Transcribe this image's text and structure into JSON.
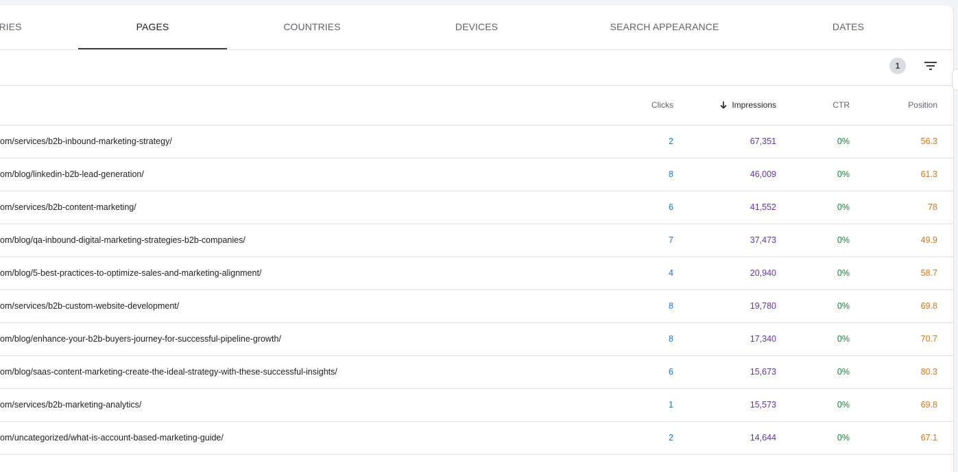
{
  "tabs": [
    {
      "label": "RIES",
      "active": false
    },
    {
      "label": "PAGES",
      "active": true
    },
    {
      "label": "COUNTRIES",
      "active": false
    },
    {
      "label": "DEVICES",
      "active": false
    },
    {
      "label": "SEARCH APPEARANCE",
      "active": false
    },
    {
      "label": "DATES",
      "active": false
    }
  ],
  "toolbar": {
    "filter_count": "1",
    "filter_icon": "filter-list-icon"
  },
  "table": {
    "headers": {
      "clicks": "Clicks",
      "impressions": "Impressions",
      "ctr": "CTR",
      "position": "Position"
    },
    "sort": {
      "column": "impressions",
      "direction": "descending",
      "icon": "arrow-down-icon"
    },
    "rows": [
      {
        "page": "om/services/b2b-inbound-marketing-strategy/",
        "clicks": "2",
        "impressions": "67,351",
        "ctr": "0%",
        "position": "56.3"
      },
      {
        "page": "om/blog/linkedin-b2b-lead-generation/",
        "clicks": "8",
        "impressions": "46,009",
        "ctr": "0%",
        "position": "61.3"
      },
      {
        "page": "om/services/b2b-content-marketing/",
        "clicks": "6",
        "impressions": "41,552",
        "ctr": "0%",
        "position": "78"
      },
      {
        "page": "om/blog/qa-inbound-digital-marketing-strategies-b2b-companies/",
        "clicks": "7",
        "impressions": "37,473",
        "ctr": "0%",
        "position": "49.9"
      },
      {
        "page": "om/blog/5-best-practices-to-optimize-sales-and-marketing-alignment/",
        "clicks": "4",
        "impressions": "20,940",
        "ctr": "0%",
        "position": "58.7"
      },
      {
        "page": "om/services/b2b-custom-website-development/",
        "clicks": "8",
        "impressions": "19,780",
        "ctr": "0%",
        "position": "69.8"
      },
      {
        "page": "om/blog/enhance-your-b2b-buyers-journey-for-successful-pipeline-growth/",
        "clicks": "8",
        "impressions": "17,340",
        "ctr": "0%",
        "position": "70.7"
      },
      {
        "page": "om/blog/saas-content-marketing-create-the-ideal-strategy-with-these-successful-insights/",
        "clicks": "6",
        "impressions": "15,673",
        "ctr": "0%",
        "position": "80.3"
      },
      {
        "page": "om/services/b2b-marketing-analytics/",
        "clicks": "1",
        "impressions": "15,573",
        "ctr": "0%",
        "position": "69.8"
      },
      {
        "page": "om/uncategorized/what-is-account-based-marketing-guide/",
        "clicks": "2",
        "impressions": "14,644",
        "ctr": "0%",
        "position": "67.1"
      }
    ]
  },
  "colors": {
    "clicks": "#1a73e8",
    "impressions": "#5e35b1",
    "ctr": "#188038",
    "position": "#e8710a"
  }
}
